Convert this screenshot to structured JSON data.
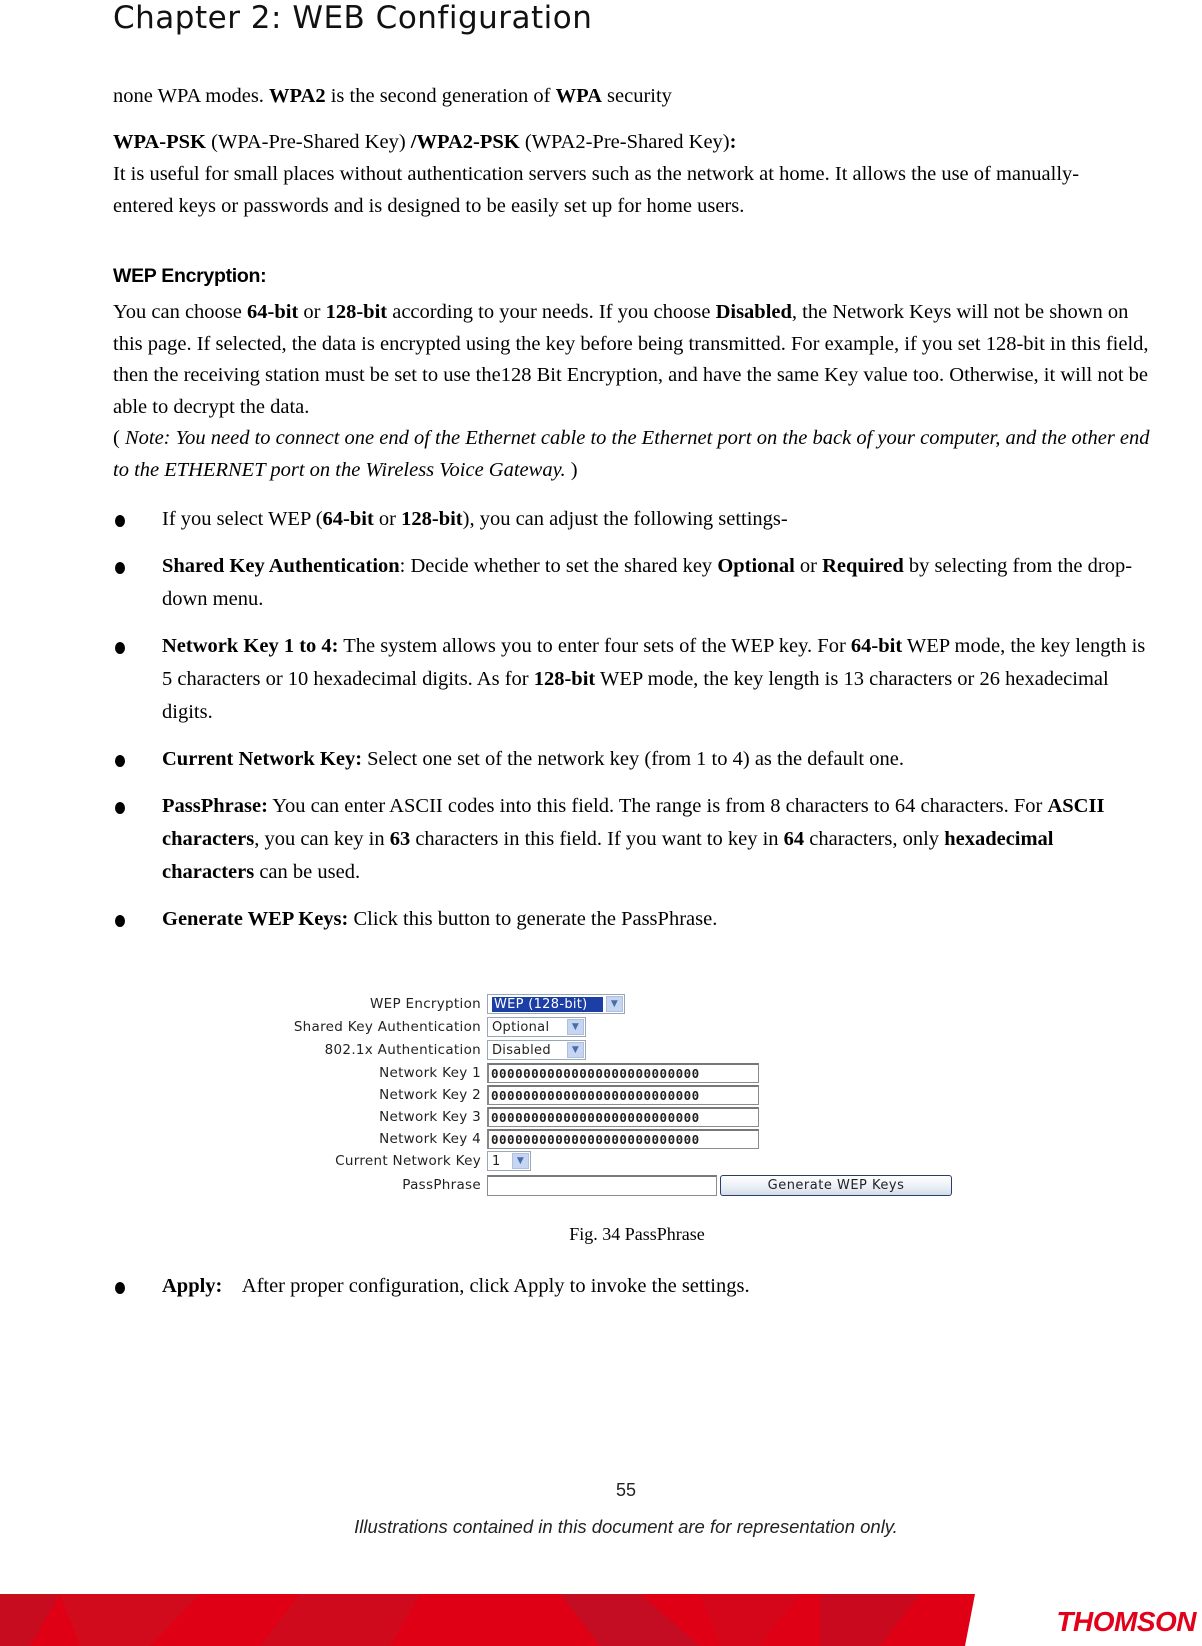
{
  "header": {
    "chapter_title": "Chapter 2: WEB Configuration"
  },
  "intro": {
    "line1": {
      "t1": "none WPA modes. ",
      "b1": "WPA2",
      "t2": " is the second generation of ",
      "b2": "WPA",
      "t3": " security"
    },
    "psk": {
      "b1": "WPA-PSK",
      "t1": " (WPA-Pre-Shared Key) ",
      "b2": "/WPA2-PSK",
      "t2": " (WPA2-Pre-Shared Key)",
      "b3": ":",
      "desc": "It is useful for small places without authentication servers such as the network at home. It allows the use of manually-entered keys or passwords and is designed to be easily set up for home users."
    }
  },
  "wep_section": {
    "heading": "WEP Encryption:",
    "para": {
      "t1": "You can choose ",
      "b1": "64-bit",
      "t2": " or ",
      "b2": "128-bit",
      "t3": " according to your needs. If you choose ",
      "b3": "Disabled",
      "t4": ", the Network Keys will not be shown on this page. If selected, the data is encrypted using the key before being transmitted. For example, if you set 128-bit in this field, then the receiving station must be set to use the128 Bit Encryption, and have the same Key value too. Otherwise, it will not be able to decrypt the data.",
      "note_open": "( ",
      "note": "Note: You need to connect one end of the Ethernet cable to the Ethernet port on the back of your computer, and the other end to the ETHERNET port on the Wireless Voice Gateway.",
      "note_close": " )"
    }
  },
  "bullets": [
    {
      "t1": "If you select WEP (",
      "b1": "64-bit",
      "t2": " or ",
      "b2": "128-bit",
      "t3": "), you can adjust the following settings-"
    },
    {
      "b1": "Shared Key Authentication",
      "t1": ": Decide whether to set the shared key ",
      "b2": "Optional",
      "t2": " or ",
      "b3": "Required",
      "t3": " by selecting from the drop-down menu."
    },
    {
      "b1": "Network Key 1 to 4:",
      "t1": " The system allows you to enter four sets of the WEP key. For ",
      "b2": "64-bit",
      "t2": " WEP mode, the key length is 5 characters or 10 hexadecimal digits. As for ",
      "b3": "128-bit",
      "t3": " WEP mode, the key length is 13 characters or 26 hexadecimal digits."
    },
    {
      "b1": "Current Network Key:",
      "t1": " Select one set of the network key (from 1 to 4) as the default one."
    },
    {
      "b1": "PassPhrase:",
      "t1": " You can enter ASCII codes into this field. The range is from 8 characters to 64 characters. For ",
      "b2": "ASCII characters",
      "t2": ", you can key in ",
      "b3": "63",
      "t3": " characters in this field. If you want to key in ",
      "b4": "64",
      "t4": " characters, only ",
      "b5": "hexadecimal characters",
      "t5": " can be used."
    },
    {
      "b1": "Generate WEP Keys:",
      "t1": " Click this button to generate the PassPhrase."
    }
  ],
  "figure": {
    "wep_encryption": {
      "label": "WEP Encryption",
      "value": "WEP (128-bit)"
    },
    "shared_key_auth": {
      "label": "Shared Key Authentication",
      "value": "Optional"
    },
    "dot1x_auth": {
      "label": "802.1x Authentication",
      "value": "Disabled"
    },
    "network_keys": [
      {
        "label": "Network Key 1",
        "value": "00000000000000000000000000"
      },
      {
        "label": "Network Key 2",
        "value": "00000000000000000000000000"
      },
      {
        "label": "Network Key 3",
        "value": "00000000000000000000000000"
      },
      {
        "label": "Network Key 4",
        "value": "00000000000000000000000000"
      }
    ],
    "current_network_key": {
      "label": "Current Network Key",
      "value": "1"
    },
    "passphrase": {
      "label": "PassPhrase",
      "value": ""
    },
    "generate_button": "Generate WEP Keys",
    "dropdown_arrow_icon": "chevron-down",
    "caption": "Fig. 34 PassPhrase"
  },
  "apply_bullet": {
    "b1": "Apply:",
    "t1": "    After proper configuration, click Apply to invoke the settings."
  },
  "footer": {
    "page_number": "55",
    "note": "Illustrations contained in this document are for representation only.",
    "brand": "THOMSON",
    "colors": {
      "brand_red": "#e3001b",
      "band_red": "#e00016",
      "band_dark": "#c80a1e"
    }
  }
}
